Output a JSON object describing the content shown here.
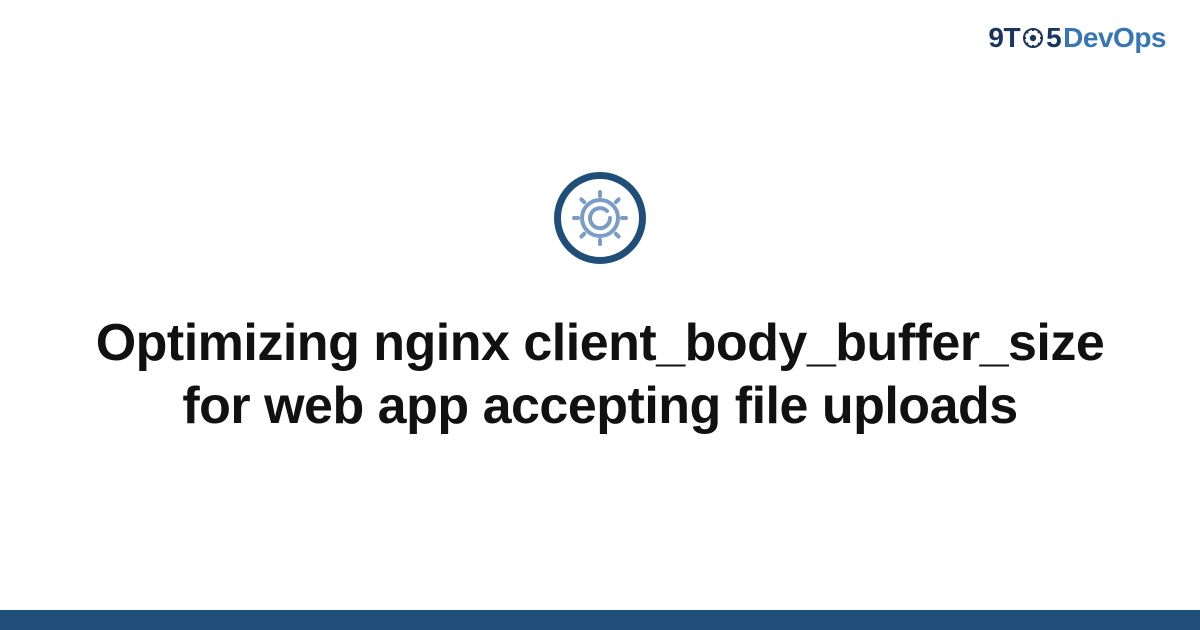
{
  "brand": {
    "part1": "9T",
    "part2": "5",
    "part3": "DevOps"
  },
  "icon": {
    "ring_name": "gear-ring-icon",
    "inner_name": "gear-icon"
  },
  "title": "Optimizing nginx client_body_buffer_size for web app accepting file uploads",
  "colors": {
    "brand_dark": "#1a365d",
    "brand_blue": "#3776b5",
    "ring": "#1f4e79",
    "gear_light": "#7a9cc6",
    "footer": "#1f4e79"
  }
}
